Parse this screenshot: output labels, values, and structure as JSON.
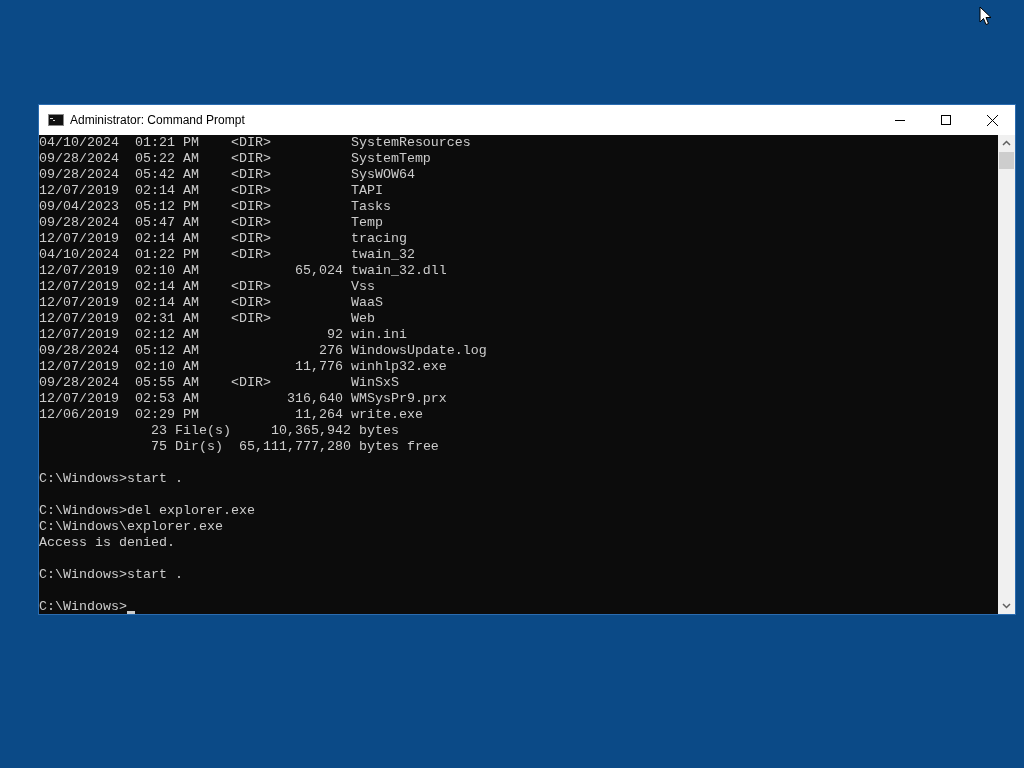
{
  "window": {
    "title": "Administrator: Command Prompt"
  },
  "listing": [
    {
      "date": "04/10/2024",
      "time": "01:21 PM",
      "kind": "dir",
      "tag": "<DIR>",
      "name": "SystemResources"
    },
    {
      "date": "09/28/2024",
      "time": "05:22 AM",
      "kind": "dir",
      "tag": "<DIR>",
      "name": "SystemTemp"
    },
    {
      "date": "09/28/2024",
      "time": "05:42 AM",
      "kind": "dir",
      "tag": "<DIR>",
      "name": "SysWOW64"
    },
    {
      "date": "12/07/2019",
      "time": "02:14 AM",
      "kind": "dir",
      "tag": "<DIR>",
      "name": "TAPI"
    },
    {
      "date": "09/04/2023",
      "time": "05:12 PM",
      "kind": "dir",
      "tag": "<DIR>",
      "name": "Tasks"
    },
    {
      "date": "09/28/2024",
      "time": "05:47 AM",
      "kind": "dir",
      "tag": "<DIR>",
      "name": "Temp"
    },
    {
      "date": "12/07/2019",
      "time": "02:14 AM",
      "kind": "dir",
      "tag": "<DIR>",
      "name": "tracing"
    },
    {
      "date": "04/10/2024",
      "time": "01:22 PM",
      "kind": "dir",
      "tag": "<DIR>",
      "name": "twain_32"
    },
    {
      "date": "12/07/2019",
      "time": "02:10 AM",
      "kind": "file",
      "size": "65,024",
      "name": "twain_32.dll"
    },
    {
      "date": "12/07/2019",
      "time": "02:14 AM",
      "kind": "dir",
      "tag": "<DIR>",
      "name": "Vss"
    },
    {
      "date": "12/07/2019",
      "time": "02:14 AM",
      "kind": "dir",
      "tag": "<DIR>",
      "name": "WaaS"
    },
    {
      "date": "12/07/2019",
      "time": "02:31 AM",
      "kind": "dir",
      "tag": "<DIR>",
      "name": "Web"
    },
    {
      "date": "12/07/2019",
      "time": "02:12 AM",
      "kind": "file",
      "size": "92",
      "name": "win.ini"
    },
    {
      "date": "09/28/2024",
      "time": "05:12 AM",
      "kind": "file",
      "size": "276",
      "name": "WindowsUpdate.log"
    },
    {
      "date": "12/07/2019",
      "time": "02:10 AM",
      "kind": "file",
      "size": "11,776",
      "name": "winhlp32.exe"
    },
    {
      "date": "09/28/2024",
      "time": "05:55 AM",
      "kind": "dir",
      "tag": "<DIR>",
      "name": "WinSxS"
    },
    {
      "date": "12/07/2019",
      "time": "02:53 AM",
      "kind": "file",
      "size": "316,640",
      "name": "WMSysPr9.prx"
    },
    {
      "date": "12/06/2019",
      "time": "02:29 PM",
      "kind": "file",
      "size": "11,264",
      "name": "write.exe"
    }
  ],
  "summary": [
    {
      "count": "23",
      "label": "File(s)",
      "amount": "10,365,942",
      "unit": "bytes"
    },
    {
      "count": "75",
      "label": "Dir(s)",
      "amount": "65,111,777,280",
      "unit": "bytes free"
    }
  ],
  "session": [
    [
      "C:\\Windows>start ."
    ],
    [
      "C:\\Windows>del explorer.exe",
      "C:\\Windows\\explorer.exe",
      "Access is denied."
    ],
    [
      "C:\\Windows>start ."
    ]
  ],
  "prompt": "C:\\Windows>"
}
